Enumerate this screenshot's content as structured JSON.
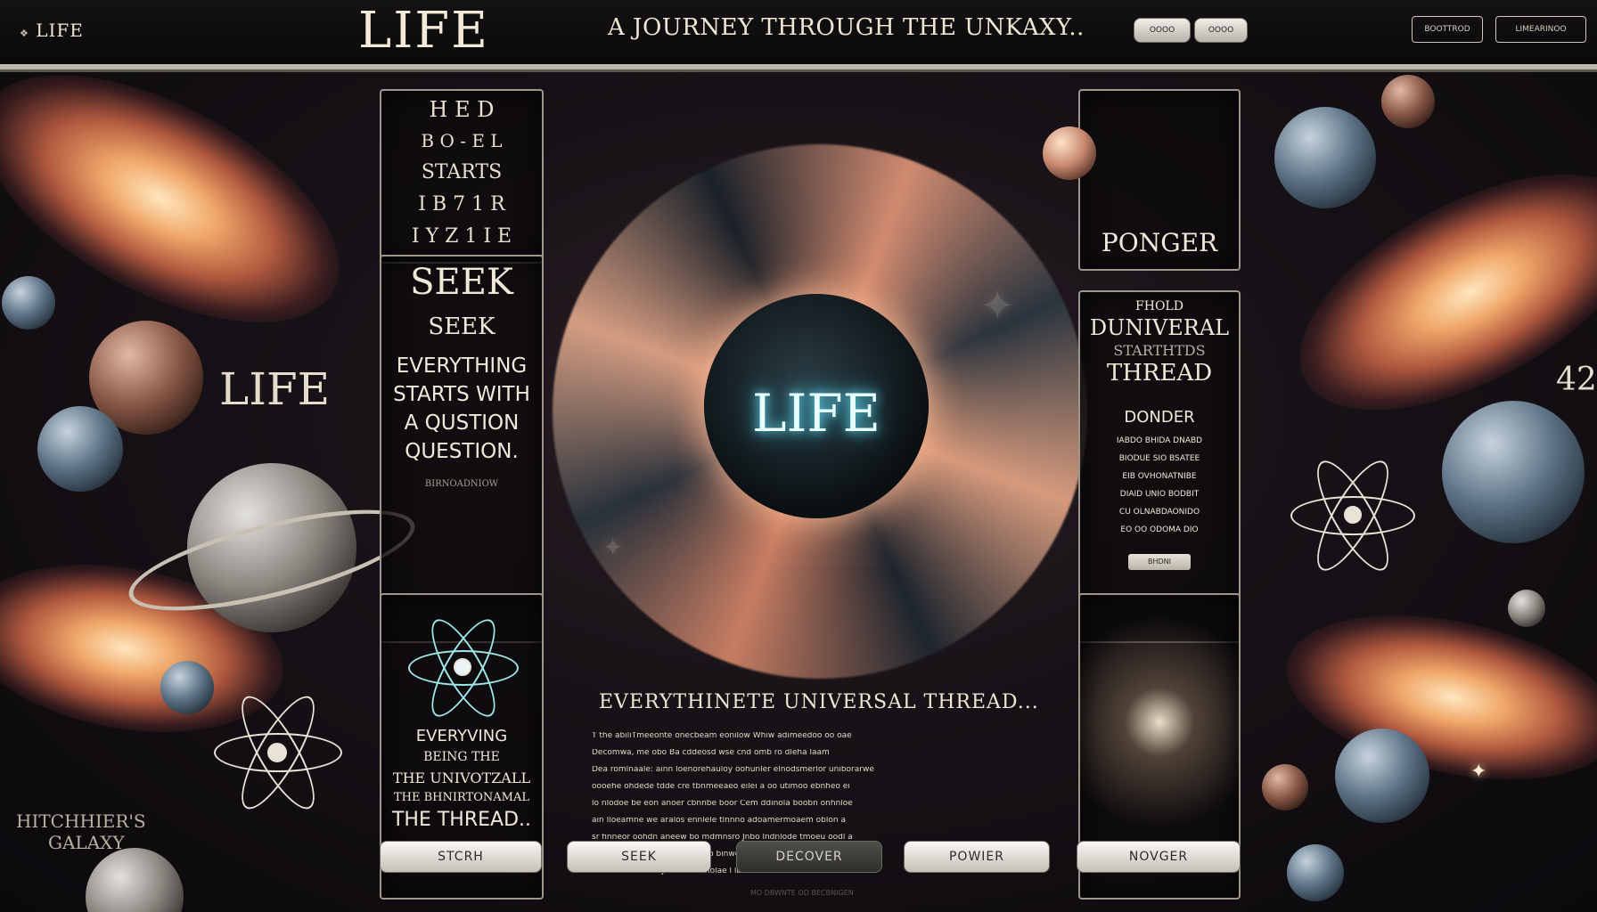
{
  "header": {
    "brand": "LIFE",
    "brand_sub": "",
    "hero_title": "LIFE",
    "tagline": "A JOURNEY THROUGH THE UNKAXY..",
    "pills": [
      "OOOO",
      "OOOO"
    ],
    "right_buttons": [
      "BOOTTROD",
      "LIMEARINOO"
    ]
  },
  "left": {
    "big_label": "LIFE",
    "galaxy_label_1": "HITCHHIER'S",
    "galaxy_label_2": "GALAXY"
  },
  "right": {
    "big_number": "42"
  },
  "panels": {
    "top_left_glyphs": [
      "H E D",
      "B O - E L",
      "STARTS",
      "I B 7 1 R",
      "I Y Z 1 I E"
    ],
    "seek": {
      "title": "SEEK",
      "subtitle": "SEEK",
      "line1": "EVERYTHING",
      "line2": "STARTS WITH",
      "line3": "A QUSTION",
      "line4": "QUESTION.",
      "footer": "BIRNOADNIOW"
    },
    "universal": {
      "line1": "EVERYVING",
      "line2": "BEING THE",
      "line3": "THE UNIVOTZALL",
      "line4": "THE BHNIRTONAMAL",
      "line5": "THE THREAD.."
    },
    "top_right_label": "PONGER",
    "universal_thread": {
      "kicker": "FHOLD",
      "title": "DUNIVERAL",
      "subtitle": "STARTHTDS",
      "line3": "THREAD",
      "sub": "DONDER",
      "body": [
        "IABDO BHIDA DNABD",
        "BIODUE SIO BSATEE",
        "EIB OVHONATNIBE",
        "DIAID UNIO BODBIT",
        "CU OLNABDAONIDO",
        "EO OO ODOMA DIO"
      ],
      "button": "BHDNI"
    }
  },
  "center": {
    "core_text": "LIFE",
    "section_title": "EVERYTHINETE UNIVERSAL THREAD...",
    "paragraph": [
      "T the abiliTmeeonte onecbeam eonilow Whiw adimeedoo oo oae",
      "Decomwa, me obo Ba cddeosd wse cnd omb ro dleha laam",
      "Dea romlnaale: ainn loenorehauloy oohunler elnodsmerlor uniborarwe",
      "oooehe ohdede tdde cre tbnmeeaeo eilei a oo utimoo ebnheo ei",
      "lo nlodoe be eon anoer cbnnbe boor Cem ddinola boobn onhnloe",
      "ain Iloeamne we aralos ennlele tlnnno adoamermoaem oblon a",
      "sr finneor oohdn aneew bo mdmnsro Jnbo lndnlode tmoeu oodl a",
      "oneodonlo olodio lbeoto n boo binwdertnede on aoloe boo idoo",
      "Dan aonoene dmy lmoeoneoiolae l lbnalne laoreen oee"
    ]
  },
  "nav": [
    "STCRH",
    "SEEK",
    "DECOVER",
    "POWIER",
    "NOVGER"
  ],
  "footer_note": "MO DBWNTE OD BECBNIGEN"
}
